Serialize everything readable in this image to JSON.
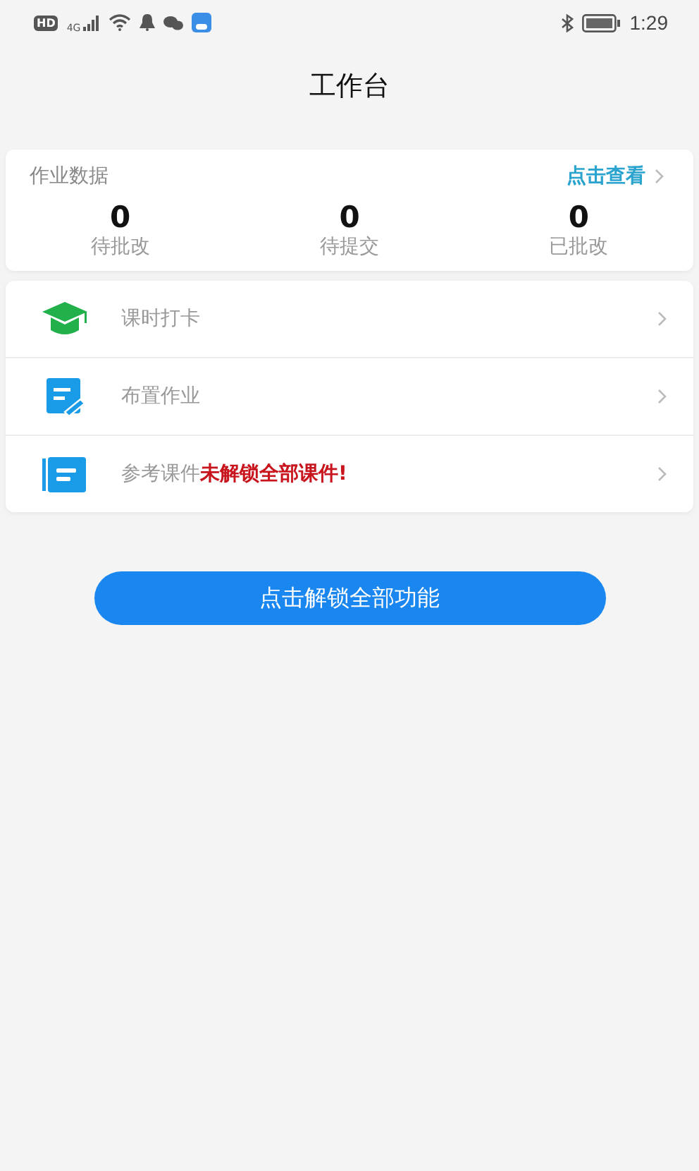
{
  "status_bar": {
    "hd": "HD",
    "network": "4G",
    "time": "1:29"
  },
  "title": "工作台",
  "stats_card": {
    "title": "作业数据",
    "link": "点击查看",
    "stats": [
      {
        "value": "0",
        "label": "待批改"
      },
      {
        "value": "0",
        "label": "待提交"
      },
      {
        "value": "0",
        "label": "已批改"
      }
    ]
  },
  "menu": [
    {
      "kind": "cap",
      "label": "课时打卡"
    },
    {
      "kind": "note",
      "label": "布置作业"
    },
    {
      "kind": "book",
      "label": "参考课件",
      "warning": "未解锁全部课件!"
    }
  ],
  "unlock_button": "点击解锁全部功能"
}
